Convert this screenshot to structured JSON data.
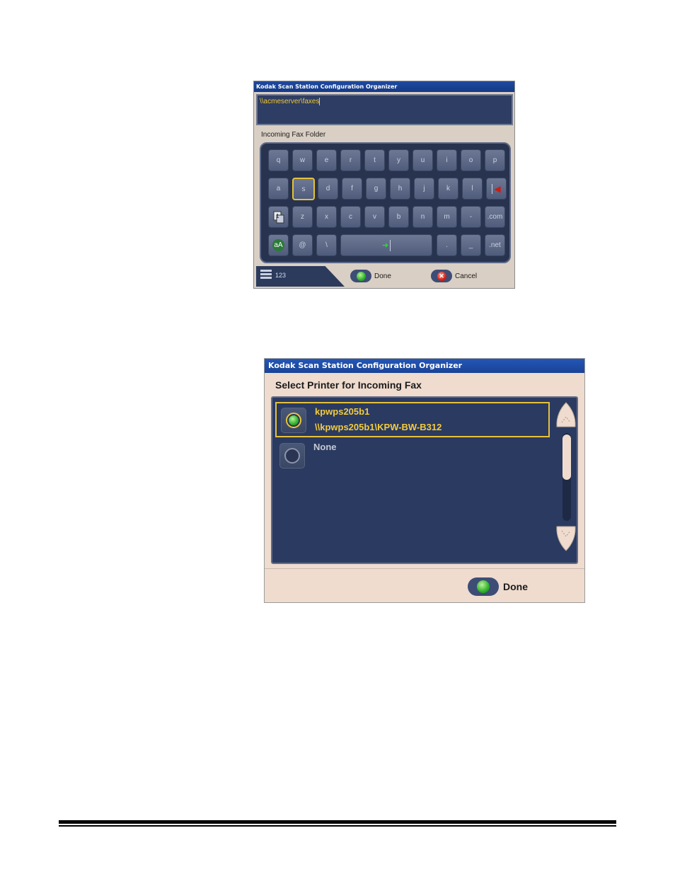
{
  "keyboard_dialog": {
    "title": "Kodak Scan Station Configuration Organizer",
    "text_value": "\\\\acmeserver\\faxes",
    "field_label": "Incoming Fax Folder",
    "rows": [
      [
        "q",
        "w",
        "e",
        "r",
        "t",
        "y",
        "u",
        "i",
        "o",
        "p"
      ],
      [
        "a",
        "s",
        "d",
        "f",
        "g",
        "h",
        "j",
        "k",
        "l"
      ],
      [
        "z",
        "x",
        "c",
        "v",
        "b",
        "n",
        "m",
        "-",
        ".com"
      ],
      [
        "@",
        "\\",
        ".",
        "_",
        ".net"
      ]
    ],
    "shift_icon": "shift-icon",
    "case_label": "aA",
    "tab_label": "123",
    "done_label": "Done",
    "cancel_label": "Cancel"
  },
  "printer_dialog": {
    "title": "Kodak Scan Station Configuration Organizer",
    "header": "Select Printer for Incoming Fax",
    "items": [
      {
        "name": "kpwps205b1",
        "path": "\\\\kpwps205b1\\KPW-BW-B312",
        "selected": true
      },
      {
        "name": "None",
        "selected": false
      }
    ],
    "done_label": "Done"
  },
  "colors": {
    "title_blue": "#1f4aa0",
    "panel_navy": "#2b3a60",
    "highlight_yellow": "#e6c13a",
    "dialog_beige": "#efdccf"
  }
}
